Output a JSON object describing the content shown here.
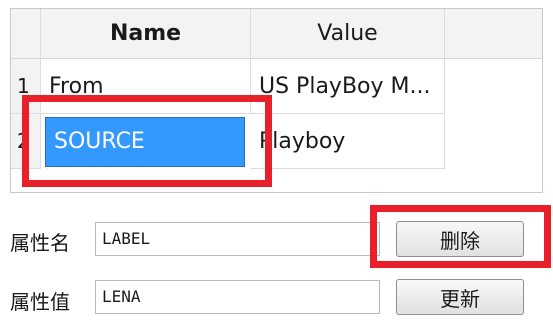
{
  "table": {
    "columns": [
      "Name",
      "Value"
    ],
    "rows": [
      {
        "index": "1",
        "name": "From",
        "value": "US PlayBoy M..."
      },
      {
        "index": "2",
        "name": "SOURCE",
        "value": "Playboy"
      }
    ]
  },
  "form": {
    "name_label": "属性名",
    "name_value": "LABEL",
    "value_label": "属性值",
    "value_value": "LENA",
    "delete_button": "删除",
    "update_button": "更新"
  },
  "colors": {
    "selection": "#3399ff",
    "highlight": "#e8202a"
  }
}
